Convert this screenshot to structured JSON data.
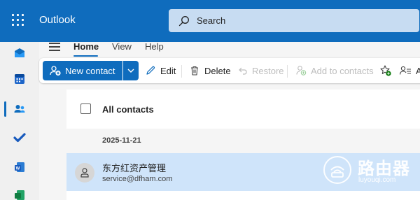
{
  "header": {
    "app_title": "Outlook",
    "search_placeholder": "Search",
    "bg_color": "#0f6cbd"
  },
  "rail": {
    "items": [
      {
        "name": "mail",
        "icon": "mail-icon"
      },
      {
        "name": "calendar",
        "icon": "calendar-icon"
      },
      {
        "name": "people",
        "icon": "people-icon",
        "active": true
      },
      {
        "name": "todo",
        "icon": "checkmark-icon"
      },
      {
        "name": "word",
        "icon": "word-icon"
      },
      {
        "name": "excel",
        "icon": "excel-icon"
      }
    ]
  },
  "nav": {
    "tabs": [
      "Home",
      "View",
      "Help"
    ],
    "active_tab": "Home"
  },
  "ribbon": {
    "new_contact": "New contact",
    "edit": "Edit",
    "delete": "Delete",
    "restore": "Restore",
    "add_to_contacts": "Add to contacts",
    "more_visible": "A"
  },
  "list": {
    "title": "All contacts",
    "group": "2025-11-21",
    "contacts": [
      {
        "name": "东方红资产管理",
        "email": "service@dfham.com",
        "selected": true
      }
    ]
  },
  "watermark": {
    "title": "路由器",
    "subtitle": "luyouqi.com"
  }
}
